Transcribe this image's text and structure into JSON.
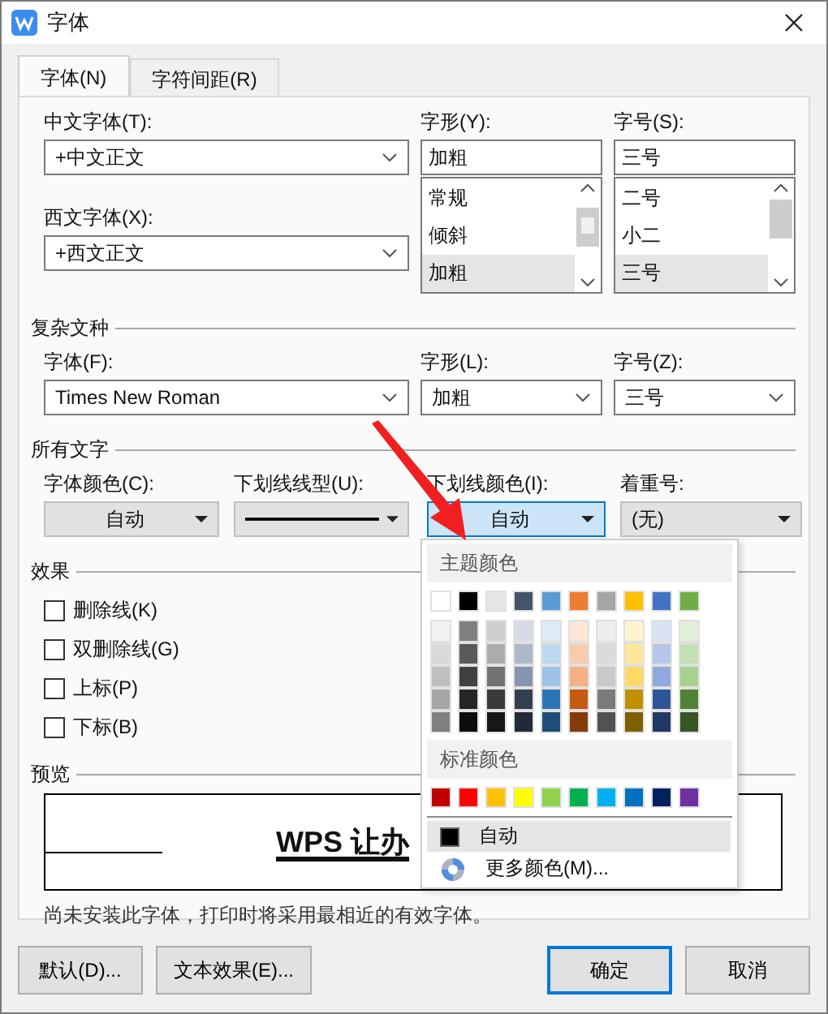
{
  "window": {
    "title": "字体"
  },
  "tabs": [
    {
      "label": "字体(N)",
      "selected": true
    },
    {
      "label": "字符间距(R)",
      "selected": false
    }
  ],
  "chinese_font": {
    "label": "中文字体(T):",
    "value": "+中文正文"
  },
  "western_font": {
    "label": "西文字体(X):",
    "value": "+西文正文"
  },
  "style": {
    "label": "字形(Y):",
    "value": "加粗",
    "options": [
      {
        "text": "常规",
        "selected": false
      },
      {
        "text": "倾斜",
        "selected": false
      },
      {
        "text": "加粗",
        "selected": true
      }
    ]
  },
  "size": {
    "label": "字号(S):",
    "value": "三号",
    "options": [
      {
        "text": "二号",
        "selected": false
      },
      {
        "text": "小二",
        "selected": false
      },
      {
        "text": "三号",
        "selected": true
      }
    ]
  },
  "complex_script": {
    "title": "复杂文种",
    "font": {
      "label": "字体(F):",
      "value": "Times New Roman"
    },
    "style": {
      "label": "字形(L):",
      "value": "加粗"
    },
    "size": {
      "label": "字号(Z):",
      "value": "三号"
    }
  },
  "all_text": {
    "title": "所有文字",
    "font_color": {
      "label": "字体颜色(C):",
      "value": "自动"
    },
    "underline_style": {
      "label": "下划线线型(U):"
    },
    "underline_color": {
      "label": "下划线颜色(I):",
      "value": "自动",
      "expanded": true
    },
    "emphasis": {
      "label": "着重号:",
      "value": "(无)"
    }
  },
  "effects": {
    "title": "效果",
    "items": [
      {
        "label": "删除线(K)",
        "checked": false
      },
      {
        "label": "双删除线(G)",
        "checked": false
      },
      {
        "label": "上标(P)",
        "checked": false
      },
      {
        "label": "下标(B)",
        "checked": false
      }
    ]
  },
  "preview": {
    "title": "预览",
    "sample": "WPS 让办",
    "note": "尚未安装此字体，打印时将采用最相近的有效字体。"
  },
  "color_menu": {
    "theme_title": "主题颜色",
    "theme_colors": [
      {
        "color": "#ffffff"
      },
      {
        "color": "#000000"
      },
      {
        "color": "#e7e6e6"
      },
      {
        "color": "#44546a"
      },
      {
        "color": "#5b9bd5"
      },
      {
        "color": "#ed7d31"
      },
      {
        "color": "#a5a5a5"
      },
      {
        "color": "#ffc000"
      },
      {
        "color": "#4472c4"
      },
      {
        "color": "#70ad47"
      }
    ],
    "shade_rows": [
      {
        "swatches": [
          {
            "color": "#f2f2f2"
          },
          {
            "color": "#7f7f7f"
          },
          {
            "color": "#d0cece"
          },
          {
            "color": "#d6dce4"
          },
          {
            "color": "#deebf6"
          },
          {
            "color": "#fbe5d5"
          },
          {
            "color": "#ededed"
          },
          {
            "color": "#fff2cc"
          },
          {
            "color": "#dae3f3"
          },
          {
            "color": "#e2efd9"
          }
        ]
      },
      {
        "swatches": [
          {
            "color": "#d9d9d9"
          },
          {
            "color": "#595959"
          },
          {
            "color": "#aeabab"
          },
          {
            "color": "#adb9ca"
          },
          {
            "color": "#bdd7ee"
          },
          {
            "color": "#f8cbad"
          },
          {
            "color": "#dbdbdb"
          },
          {
            "color": "#ffe699"
          },
          {
            "color": "#b4c7e7"
          },
          {
            "color": "#c5e0b4"
          }
        ]
      },
      {
        "swatches": [
          {
            "color": "#bfbfbf"
          },
          {
            "color": "#404040"
          },
          {
            "color": "#757171"
          },
          {
            "color": "#8496b0"
          },
          {
            "color": "#9dc3e6"
          },
          {
            "color": "#f4b183"
          },
          {
            "color": "#c9c9c9"
          },
          {
            "color": "#ffd966"
          },
          {
            "color": "#8faadc"
          },
          {
            "color": "#a9d18e"
          }
        ]
      },
      {
        "swatches": [
          {
            "color": "#a6a6a6"
          },
          {
            "color": "#262626"
          },
          {
            "color": "#3b3838"
          },
          {
            "color": "#333f4f"
          },
          {
            "color": "#2e75b5"
          },
          {
            "color": "#c55a11"
          },
          {
            "color": "#7b7b7b"
          },
          {
            "color": "#bf9000"
          },
          {
            "color": "#2f5597"
          },
          {
            "color": "#538135"
          }
        ]
      },
      {
        "swatches": [
          {
            "color": "#808080"
          },
          {
            "color": "#0d0d0d"
          },
          {
            "color": "#181717"
          },
          {
            "color": "#222a35"
          },
          {
            "color": "#1f4e79"
          },
          {
            "color": "#843c0b"
          },
          {
            "color": "#525252"
          },
          {
            "color": "#7f6000"
          },
          {
            "color": "#1f3864"
          },
          {
            "color": "#375623"
          }
        ]
      }
    ],
    "standard_title": "标准颜色",
    "standard_colors": [
      {
        "color": "#c00000"
      },
      {
        "color": "#ff0000"
      },
      {
        "color": "#ffc000"
      },
      {
        "color": "#ffff00"
      },
      {
        "color": "#92d050"
      },
      {
        "color": "#00b050"
      },
      {
        "color": "#00b0f0"
      },
      {
        "color": "#0070c0"
      },
      {
        "color": "#002060"
      },
      {
        "color": "#7030a0"
      }
    ],
    "automatic": {
      "label": "自动",
      "color": "#000000",
      "selected": true
    },
    "more": {
      "label": "更多颜色(M)..."
    }
  },
  "buttons": [
    {
      "label": "默认(D)...",
      "kind": "normal"
    },
    {
      "label": "文本效果(E)...",
      "kind": "normal"
    },
    {
      "label": "确定",
      "kind": "primary"
    },
    {
      "label": "取消",
      "kind": "normal"
    }
  ]
}
